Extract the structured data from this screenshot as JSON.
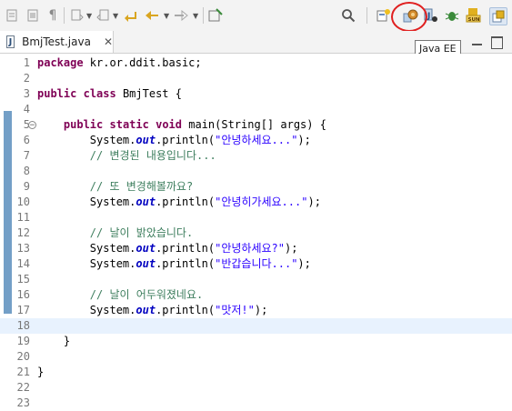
{
  "toolbar": {
    "tooltip": "Java EE",
    "sun_label": "SUN"
  },
  "editor_tab": {
    "icon_letter": "J",
    "label": "BmjTest.java",
    "close_glyph": "✕"
  },
  "editor": {
    "lines": [
      {
        "n": "1",
        "tokens": [
          {
            "c": "kw",
            "t": "package"
          },
          {
            "c": "",
            "t": " kr.or.ddit.basic;"
          }
        ]
      },
      {
        "n": "2",
        "tokens": []
      },
      {
        "n": "3",
        "tokens": [
          {
            "c": "kw",
            "t": "public"
          },
          {
            "c": "",
            "t": " "
          },
          {
            "c": "kw",
            "t": "class"
          },
          {
            "c": "",
            "t": " BmjTest {"
          }
        ]
      },
      {
        "n": "4",
        "tokens": []
      },
      {
        "n": "5",
        "fold": true,
        "tokens": [
          {
            "c": "",
            "t": "    "
          },
          {
            "c": "kw",
            "t": "public"
          },
          {
            "c": "",
            "t": " "
          },
          {
            "c": "kw",
            "t": "static"
          },
          {
            "c": "",
            "t": " "
          },
          {
            "c": "kw",
            "t": "void"
          },
          {
            "c": "",
            "t": " main(String[] args) {"
          }
        ]
      },
      {
        "n": "6",
        "tokens": [
          {
            "c": "",
            "t": "        System."
          },
          {
            "c": "fld",
            "t": "out"
          },
          {
            "c": "",
            "t": ".println("
          },
          {
            "c": "str",
            "t": "\"안녕하세요...\""
          },
          {
            "c": "",
            "t": ");"
          }
        ]
      },
      {
        "n": "7",
        "tokens": [
          {
            "c": "cm",
            "t": "        // 변경된 내용입니다..."
          }
        ]
      },
      {
        "n": "8",
        "tokens": []
      },
      {
        "n": "9",
        "tokens": [
          {
            "c": "cm",
            "t": "        // 또 변경해볼까요?"
          }
        ]
      },
      {
        "n": "10",
        "tokens": [
          {
            "c": "",
            "t": "        System."
          },
          {
            "c": "fld",
            "t": "out"
          },
          {
            "c": "",
            "t": ".println("
          },
          {
            "c": "str",
            "t": "\"안녕히가세요...\""
          },
          {
            "c": "",
            "t": ");"
          }
        ]
      },
      {
        "n": "11",
        "tokens": []
      },
      {
        "n": "12",
        "tokens": [
          {
            "c": "cm",
            "t": "        // 날이 밝았습니다."
          }
        ]
      },
      {
        "n": "13",
        "tokens": [
          {
            "c": "",
            "t": "        System."
          },
          {
            "c": "fld",
            "t": "out"
          },
          {
            "c": "",
            "t": ".println("
          },
          {
            "c": "str",
            "t": "\"안녕하세요?\""
          },
          {
            "c": "",
            "t": ");"
          }
        ]
      },
      {
        "n": "14",
        "tokens": [
          {
            "c": "",
            "t": "        System."
          },
          {
            "c": "fld",
            "t": "out"
          },
          {
            "c": "",
            "t": ".println("
          },
          {
            "c": "str",
            "t": "\"반갑습니다...\""
          },
          {
            "c": "",
            "t": ");"
          }
        ]
      },
      {
        "n": "15",
        "tokens": []
      },
      {
        "n": "16",
        "tokens": [
          {
            "c": "cm",
            "t": "        // 날이 어두워졌네요."
          }
        ]
      },
      {
        "n": "17",
        "tokens": [
          {
            "c": "",
            "t": "        System."
          },
          {
            "c": "fld",
            "t": "out"
          },
          {
            "c": "",
            "t": ".println("
          },
          {
            "c": "str",
            "t": "\"맛저!\""
          },
          {
            "c": "",
            "t": ");"
          }
        ]
      },
      {
        "n": "18",
        "current": true,
        "tokens": []
      },
      {
        "n": "19",
        "tokens": [
          {
            "c": "",
            "t": "    }"
          }
        ]
      },
      {
        "n": "20",
        "tokens": []
      },
      {
        "n": "21",
        "tokens": [
          {
            "c": "",
            "t": "}"
          }
        ]
      },
      {
        "n": "22",
        "tokens": []
      },
      {
        "n": "23",
        "tokens": []
      }
    ]
  },
  "colors": {
    "keyword": "#7f0055",
    "string": "#2a00ff",
    "comment": "#3f7f5f",
    "field": "#0000c0",
    "highlight_ring": "#e02020",
    "change_ruler": "#5b8ebd"
  }
}
